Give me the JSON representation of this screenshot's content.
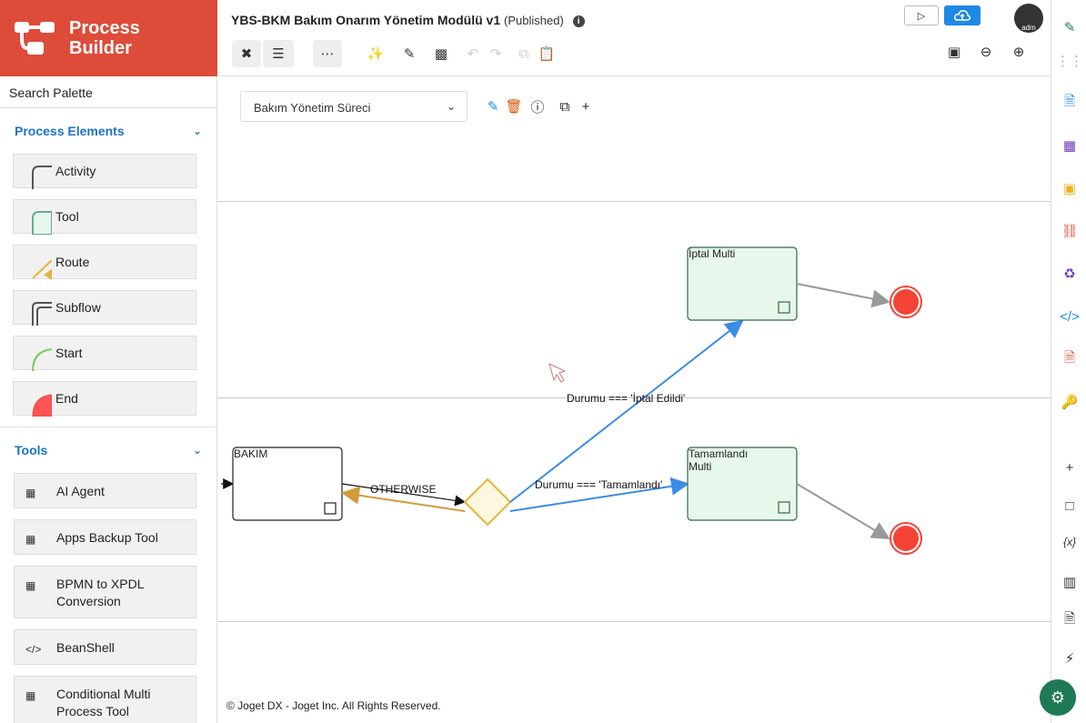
{
  "brand": {
    "line1": "Process",
    "line2": "Builder"
  },
  "sidebar": {
    "search_label": "Search Palette",
    "process_elements_title": "Process Elements",
    "process_elements": [
      "Activity",
      "Tool",
      "Route",
      "Subflow",
      "Start",
      "End"
    ],
    "tools_title": "Tools",
    "tools": [
      "AI Agent",
      "Apps Backup Tool",
      "BPMN to XPDL Conversion",
      "BeanShell",
      "Conditional Multi Process Tool"
    ]
  },
  "header": {
    "title": "YBS-BKM Bakım Onarım Yönetim Modülü v1",
    "status": "(Published)",
    "avatar_text": "adm"
  },
  "canvas": {
    "process_select": "Bakım Yönetim Süreci",
    "nodes": {
      "bakim": "BAKIM",
      "iptal": "İptal Multi",
      "tamamlandi_1": "Tamamlandı",
      "tamamlandi_2": "Multi"
    },
    "edges": {
      "otherwise": "OTHERWISE",
      "iptal_cond": "Durumu === 'İptal Edildi'",
      "tamam_cond": "Durumu === 'Tamamlandı'"
    }
  },
  "footer": {
    "text": "© Joget DX - Joget Inc. All Rights Reserved."
  },
  "colors": {
    "brand": "#dd4b39",
    "accent": "#1e88e5",
    "link": "#1a73c8",
    "end": "#f44336"
  }
}
